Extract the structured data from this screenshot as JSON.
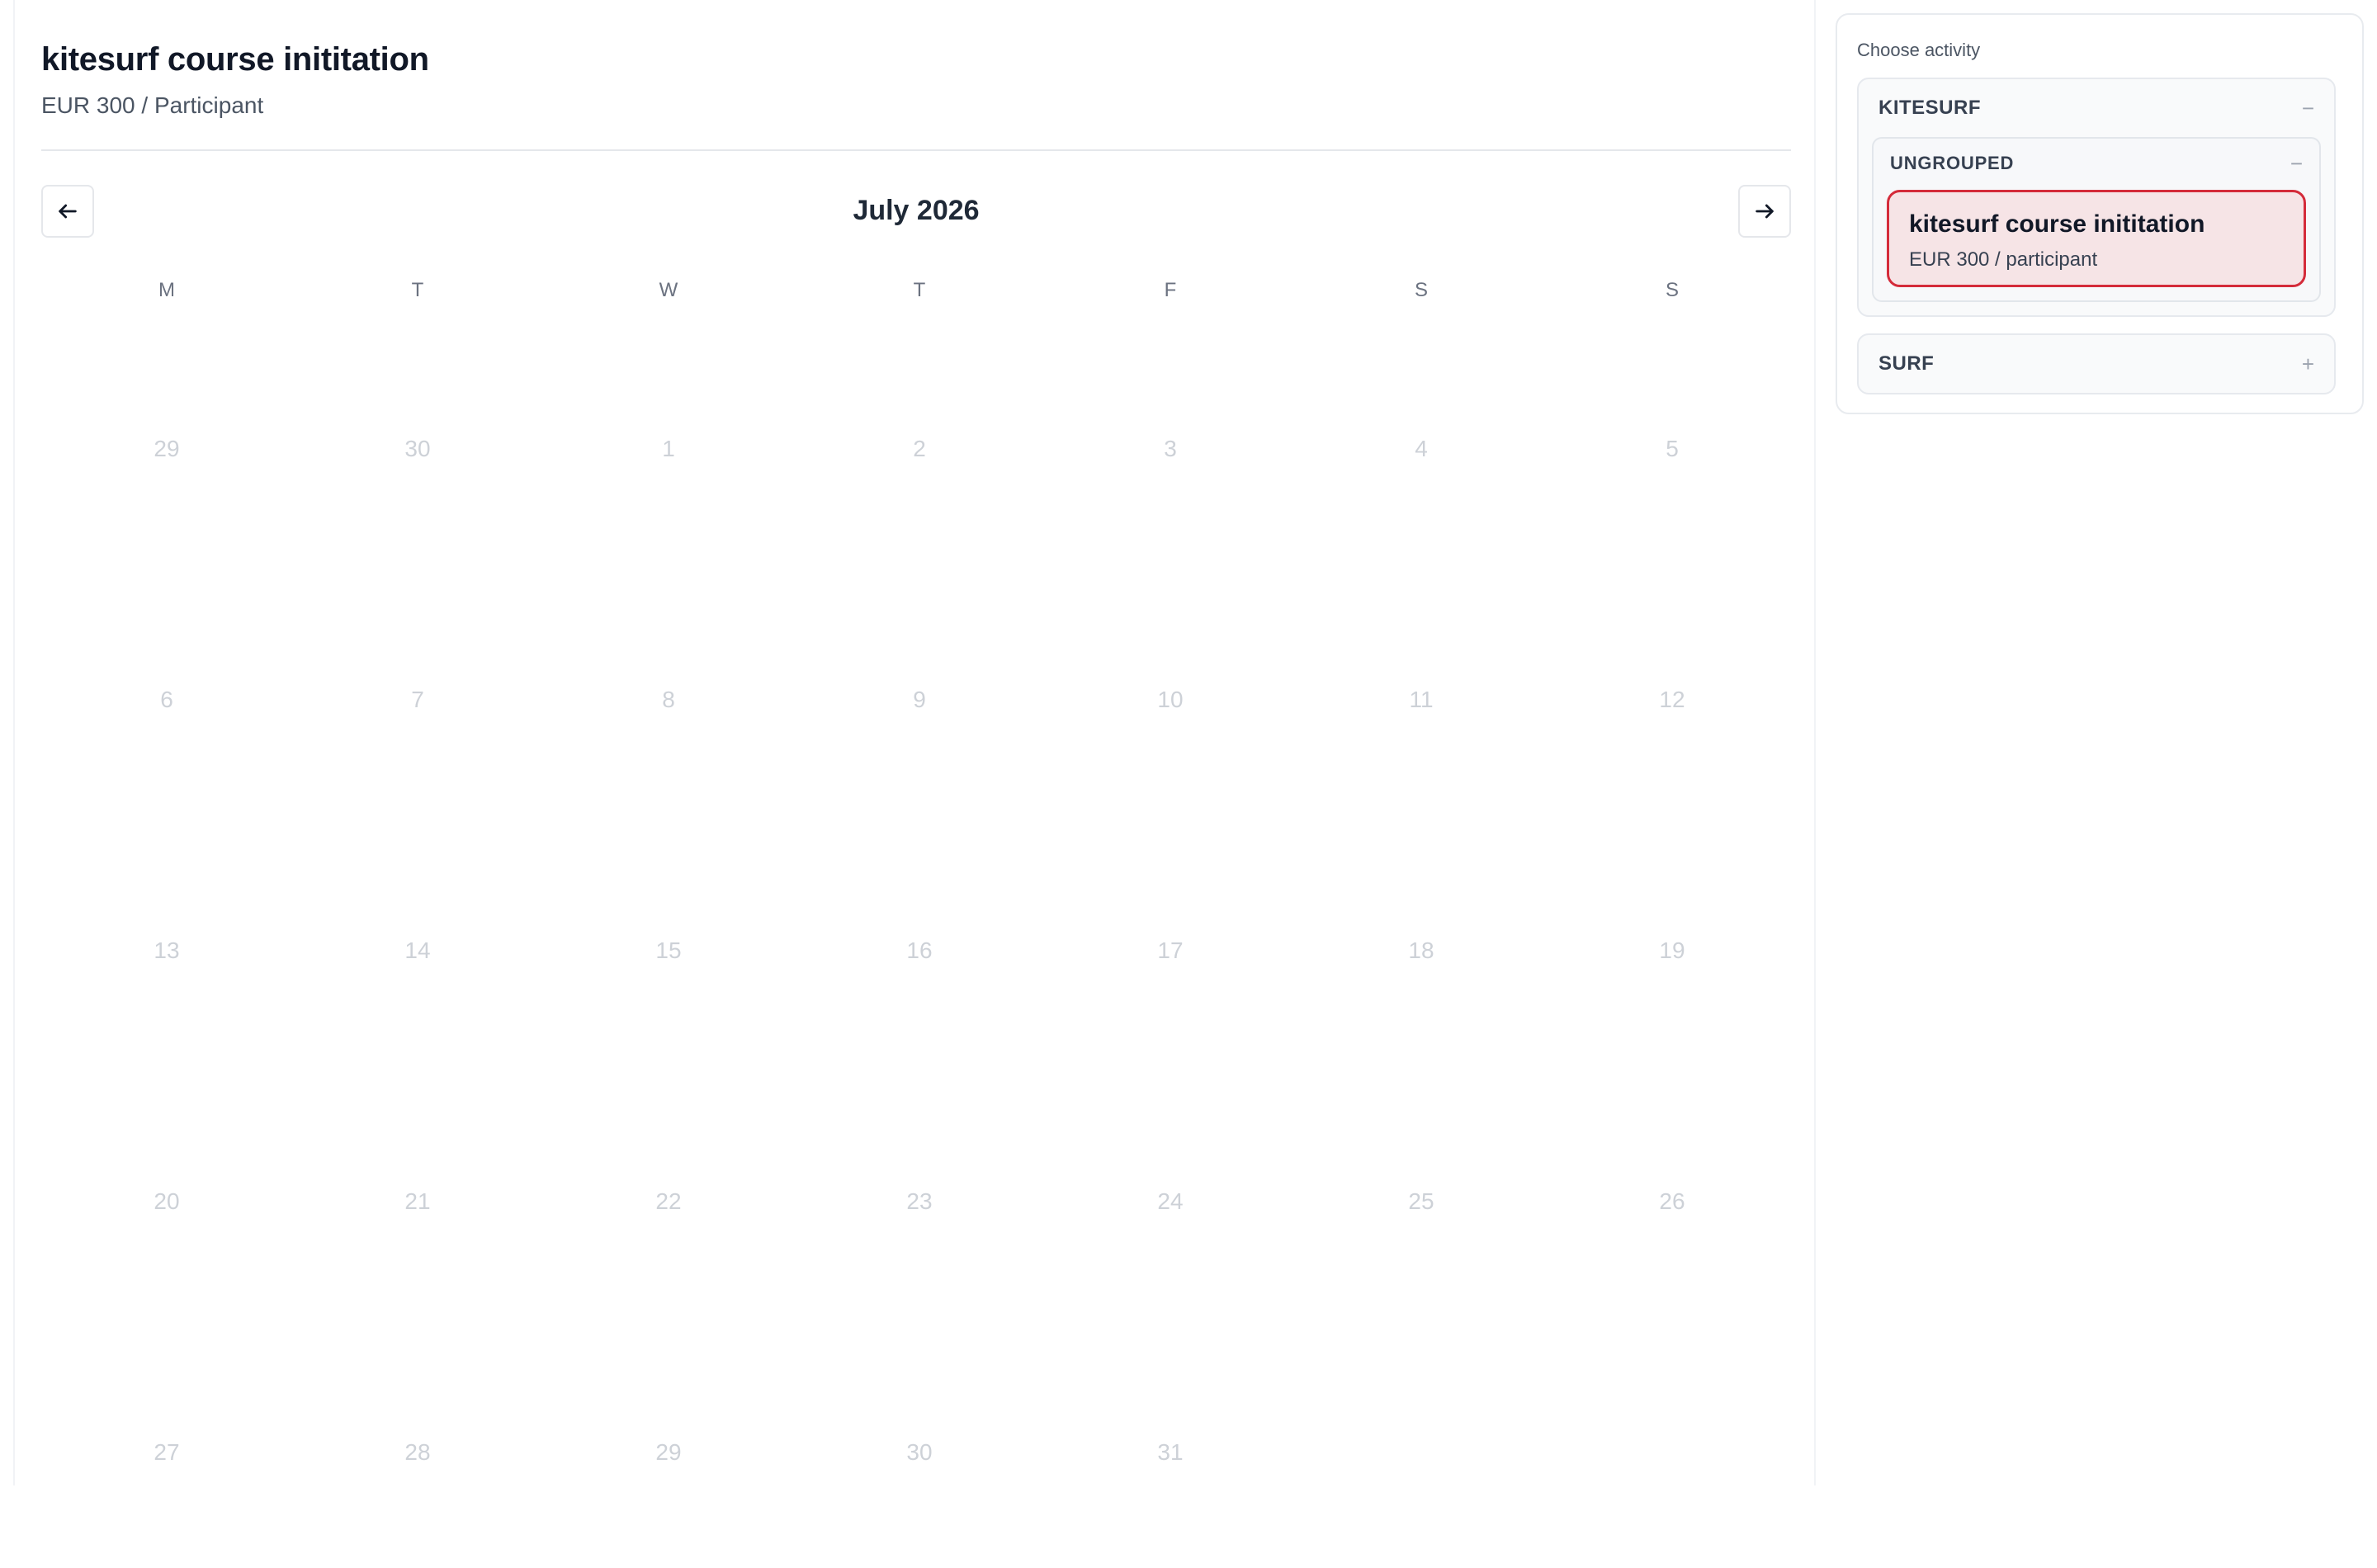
{
  "header": {
    "title": "kitesurf course inititation",
    "price": "EUR 300 / Participant"
  },
  "calendar": {
    "month_label": "July 2026",
    "prev_icon": "arrow-left-icon",
    "next_icon": "arrow-right-icon",
    "weekdays": [
      "M",
      "T",
      "W",
      "T",
      "F",
      "S",
      "S"
    ],
    "days": [
      "29",
      "30",
      "1",
      "2",
      "3",
      "4",
      "5",
      "6",
      "7",
      "8",
      "9",
      "10",
      "11",
      "12",
      "13",
      "14",
      "15",
      "16",
      "17",
      "18",
      "19",
      "20",
      "21",
      "22",
      "23",
      "24",
      "25",
      "26",
      "27",
      "28",
      "29",
      "30",
      "31"
    ]
  },
  "sidebar": {
    "title": "Choose activity",
    "groups": [
      {
        "label": "KITESURF",
        "toggle": "−",
        "subgroups": [
          {
            "label": "UNGROUPED",
            "toggle": "−",
            "activities": [
              {
                "name": "kitesurf course inititation",
                "price": "EUR 300 / participant"
              }
            ]
          }
        ]
      },
      {
        "label": "SURF",
        "toggle": "+"
      }
    ]
  },
  "colors": {
    "selected_border": "#d42b3a",
    "selected_background": "#f6e4e6",
    "inactive_day": "#cdd1d7"
  }
}
